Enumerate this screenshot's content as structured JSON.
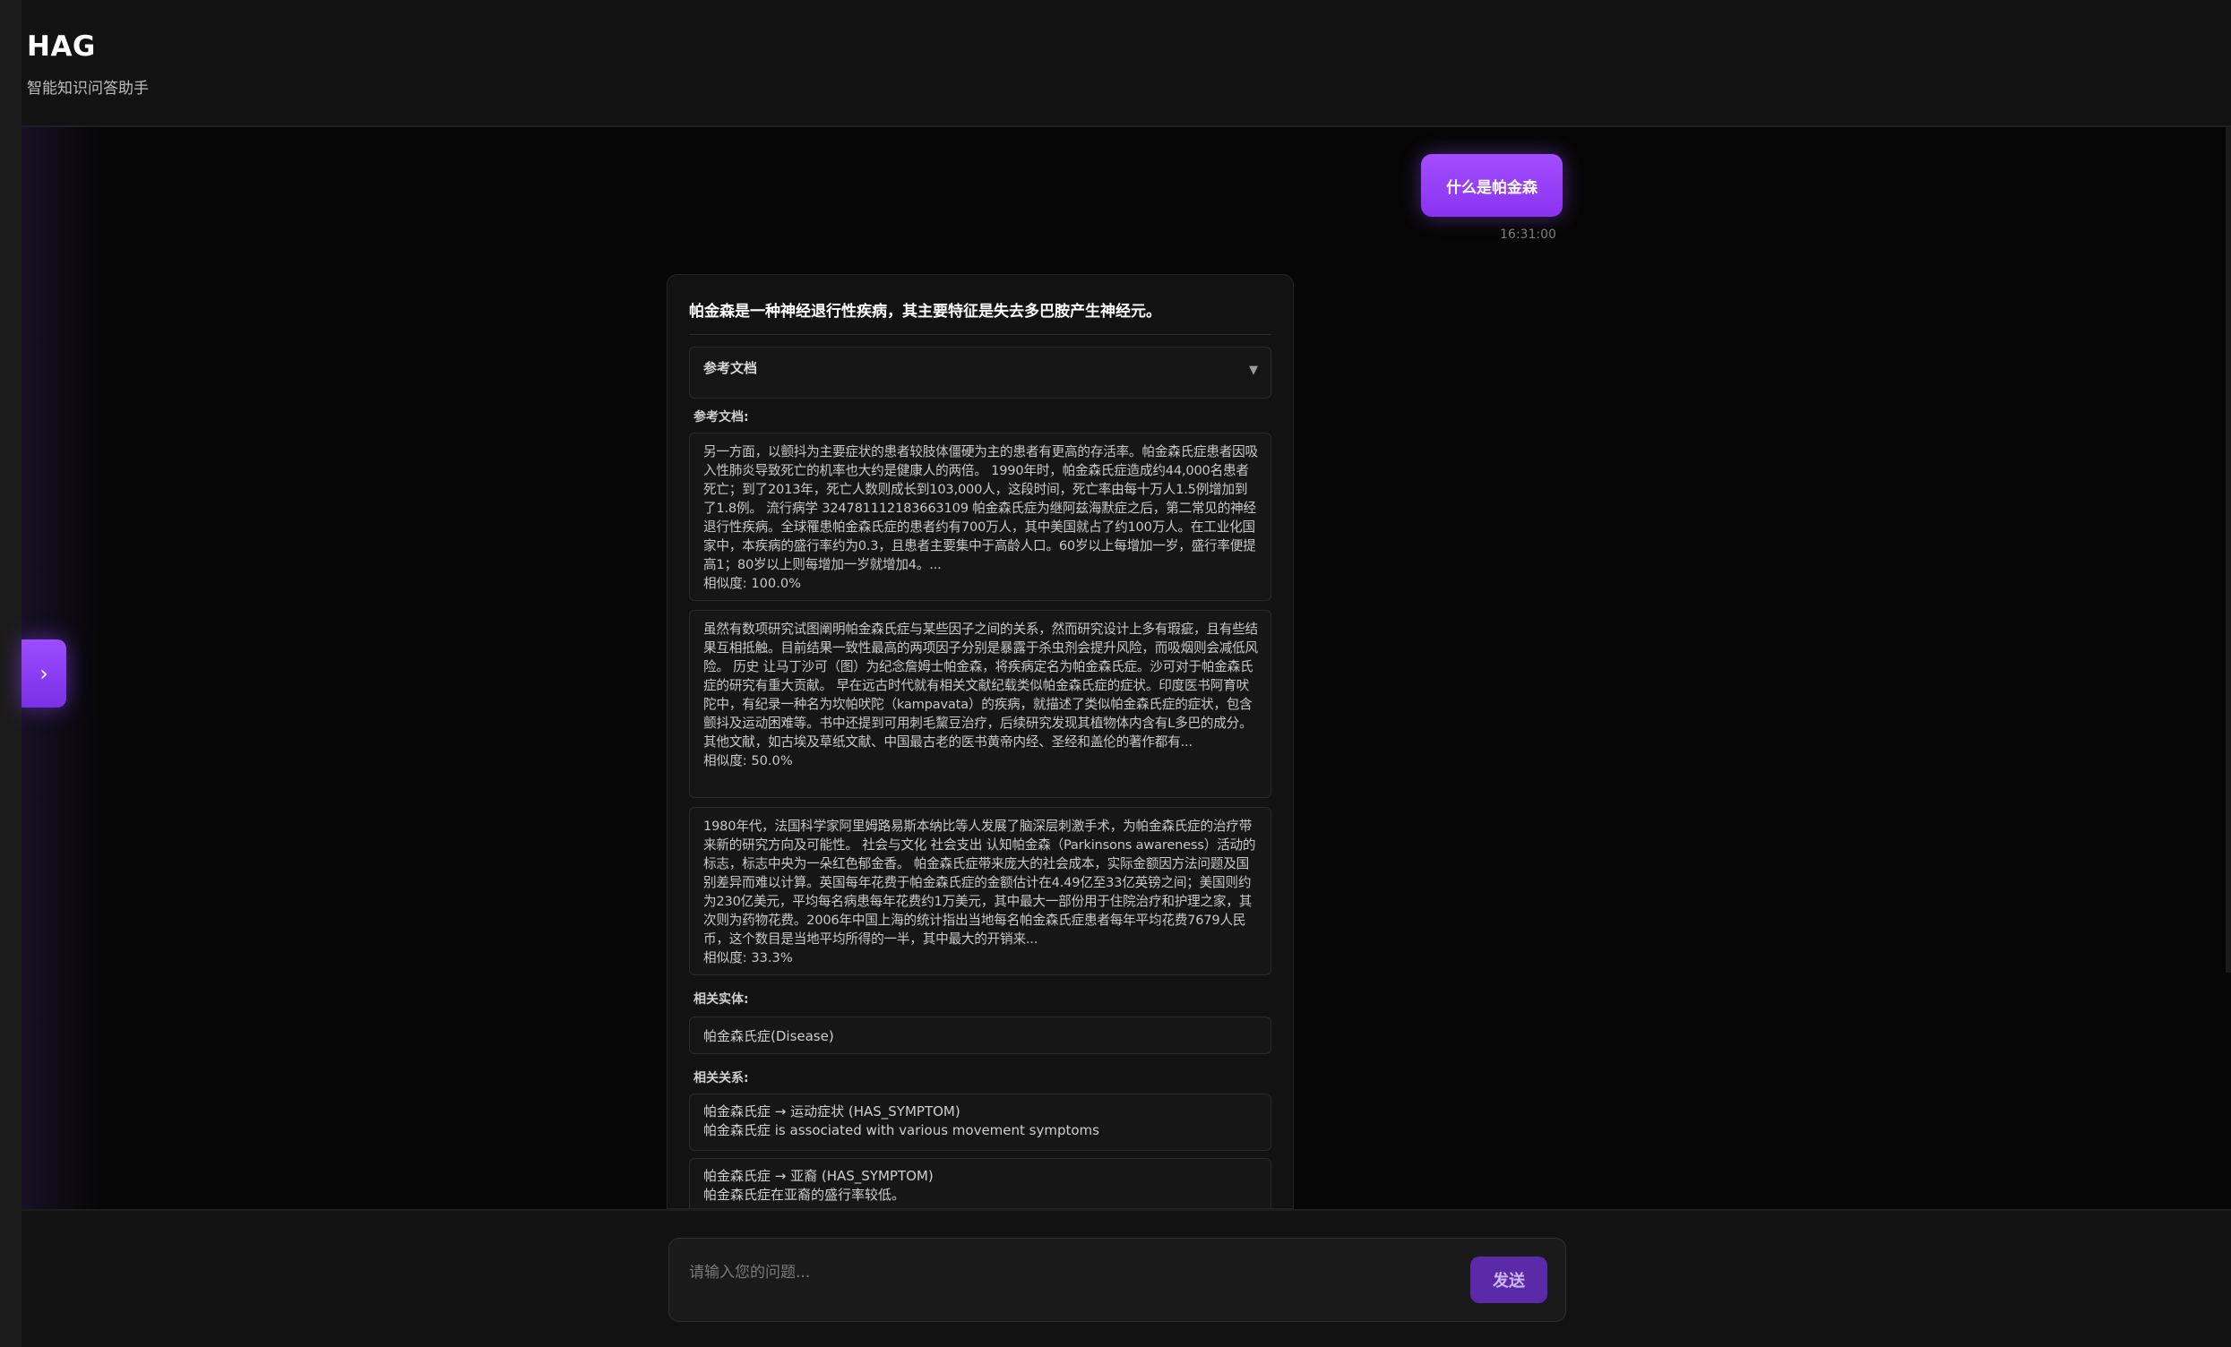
{
  "header": {
    "title": "HAG",
    "subtitle": "智能知识问答助手"
  },
  "sidebar_toggle": {
    "icon": "chevron-right-icon",
    "glyph": "›"
  },
  "chat": {
    "user_message": {
      "text": "什么是帕金森",
      "time": "16:31:00"
    },
    "bot_message": {
      "answer": "帕金森是一种神经退行性疾病，其主要特征是失去多巴胺产生神经元。",
      "ref_summary_label": "参考文档",
      "ref_summary_caret": "▼",
      "documents_label": "参考文档:",
      "documents": [
        {
          "text": "另一方面，以颤抖为主要症状的患者较肢体僵硬为主的患者有更高的存活率。帕金森氏症患者因吸入性肺炎导致死亡的机率也大约是健康人的两倍。 1990年时，帕金森氏症造成约44,000名患者死亡；到了2013年，死亡人数则成长到103,000人，这段时间，死亡率由每十万人1.5例增加到了1.8例。 流行病学 324781112183663109 帕金森氏症为继阿兹海默症之后，第二常见的神经退行性疾病。全球罹患帕金森氏症的患者约有700万人，其中美国就占了约100万人。在工业化国家中，本疾病的盛行率约为0.3，且患者主要集中于高龄人口。60岁以上每增加一岁，盛行率便提高1；80岁以上则每增加一岁就增加4。...",
          "similarity": "相似度: 100.0%"
        },
        {
          "text": "虽然有数项研究试图阐明帕金森氏症与某些因子之间的关系，然而研究设计上多有瑕疵，且有些结果互相抵触。目前结果一致性最高的两项因子分别是暴露于杀虫剂会提升风险，而吸烟则会减低风险。 历史 让马丁沙可（图）为纪念詹姆士帕金森，将疾病定名为帕金森氏症。沙可对于帕金森氏症的研究有重大贡献。 早在远古时代就有相关文献纪载类似帕金森氏症的症状。印度医书阿育吠陀中，有纪录一种名为坎帕吠陀（kampavata）的疾病，就描述了类似帕金森氏症的症状，包含颤抖及运动困难等。书中还提到可用刺毛黧豆治疗，后续研究发现其植物体内含有L多巴的成分。 其他文献，如古埃及草纸文献、中国最古老的医书黄帝内经、圣经和盖伦的著作都有...",
          "similarity": "相似度: 50.0%"
        },
        {
          "text": "1980年代，法国科学家阿里姆路易斯本纳比等人发展了脑深层刺激手术，为帕金森氏症的治疗带来新的研究方向及可能性。 社会与文化 社会支出 认知帕金森（Parkinsons awareness）活动的标志，标志中央为一朵红色郁金香。 帕金森氏症带来庞大的社会成本，实际金额因方法问题及国别差异而难以计算。英国每年花费于帕金森氏症的金额估计在4.49亿至33亿英镑之间；美国则约为230亿美元，平均每名病患每年花费约1万美元，其中最大一部份用于住院治疗和护理之家，其次则为药物花费。2006年中国上海的统计指出当地每名帕金森氏症患者每年平均花费7679人民币，这个数目是当地平均所得的一半，其中最大的开销来...",
          "similarity": "相似度: 33.3%"
        }
      ],
      "entities_label": "相关实体:",
      "entities": [
        "帕金森氏症(Disease)"
      ],
      "relations_label": "相关关系:",
      "relations": [
        {
          "line1": "帕金森氏症 → 运动症状 (HAS_SYMPTOM)",
          "line2": "帕金森氏症 is associated with various movement symptoms"
        },
        {
          "line1": "帕金森氏症 → 亚裔 (HAS_SYMPTOM)",
          "line2": "帕金森氏症在亚裔的盛行率较低。"
        }
      ]
    }
  },
  "composer": {
    "placeholder": "请输入您的问题...",
    "send_label": "发送"
  },
  "colors": {
    "accent": "#9b4dff",
    "background": "#060606",
    "panel": "#121212"
  }
}
